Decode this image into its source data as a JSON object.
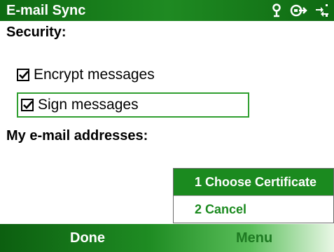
{
  "app": {
    "title": "E-mail Sync"
  },
  "status_icons": [
    "antenna-icon",
    "connectivity-icon",
    "sync-icon"
  ],
  "content": {
    "security_label": "Security:",
    "options": [
      {
        "label": "Encrypt messages",
        "checked": true
      },
      {
        "label": "Sign messages",
        "checked": true
      }
    ],
    "addresses_label": "My e-mail addresses:"
  },
  "menu": {
    "items": [
      {
        "label": "1 Choose Certificate",
        "selected": true
      },
      {
        "label": "2 Cancel",
        "selected": false
      }
    ]
  },
  "softkeys": {
    "left": "Done",
    "right": "Menu"
  },
  "colors": {
    "accent": "#1b8a1f",
    "titlebar": "#0e6a12"
  }
}
